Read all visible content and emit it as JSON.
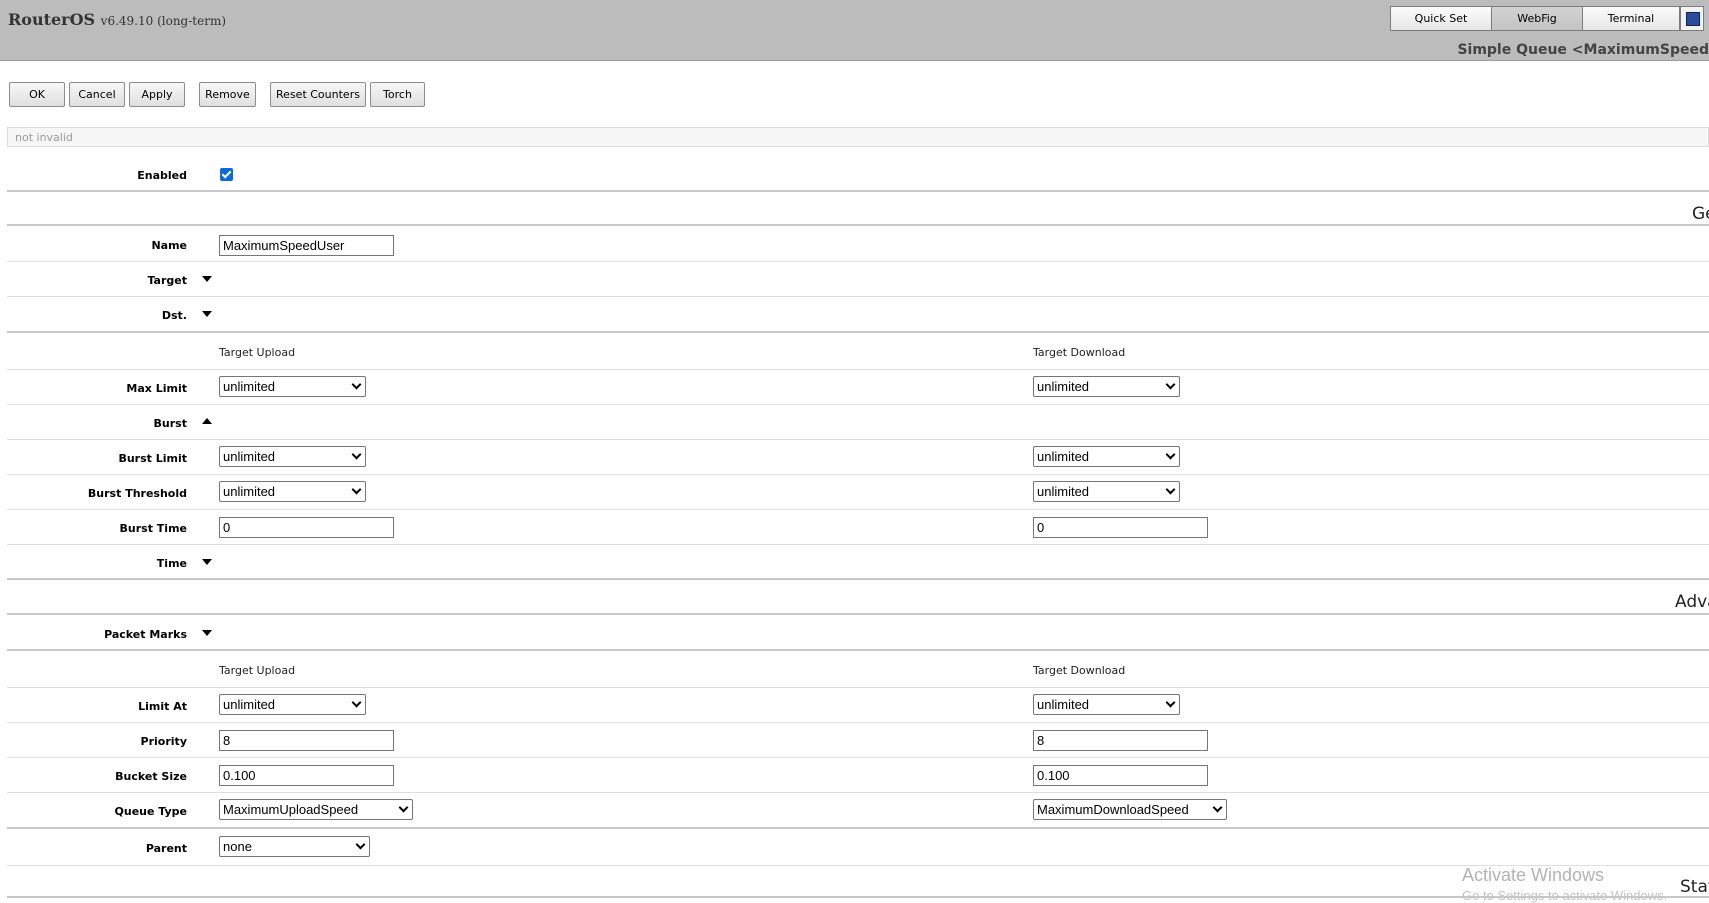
{
  "header": {
    "app_name": "RouterOS",
    "version": "v6.49.10 (long-term)",
    "modes": [
      "Quick Set",
      "WebFig",
      "Terminal"
    ],
    "active_mode": "WebFig",
    "page_title": "Simple Queue <MaximumSpeed"
  },
  "toolbar": {
    "ok": "OK",
    "cancel": "Cancel",
    "apply": "Apply",
    "remove": "Remove",
    "reset_counters": "Reset Counters",
    "torch": "Torch"
  },
  "status": "not invalid",
  "sections": {
    "general": "Ge",
    "advanced": "Adva",
    "statistics": "Stat"
  },
  "columns": {
    "upload": "Target Upload",
    "download": "Target Download"
  },
  "fields": {
    "enabled": {
      "label": "Enabled",
      "checked": true
    },
    "name": {
      "label": "Name",
      "value": "MaximumSpeedUser"
    },
    "target": {
      "label": "Target"
    },
    "dst": {
      "label": "Dst."
    },
    "max_limit": {
      "label": "Max Limit",
      "upload": "unlimited",
      "download": "unlimited"
    },
    "burst": {
      "label": "Burst"
    },
    "burst_limit": {
      "label": "Burst Limit",
      "upload": "unlimited",
      "download": "unlimited"
    },
    "burst_threshold": {
      "label": "Burst Threshold",
      "upload": "unlimited",
      "download": "unlimited"
    },
    "burst_time": {
      "label": "Burst Time",
      "upload": "0",
      "download": "0"
    },
    "time": {
      "label": "Time"
    },
    "packet_marks": {
      "label": "Packet Marks"
    },
    "limit_at": {
      "label": "Limit At",
      "upload": "unlimited",
      "download": "unlimited"
    },
    "priority": {
      "label": "Priority",
      "upload": "8",
      "download": "8"
    },
    "bucket_size": {
      "label": "Bucket Size",
      "upload": "0.100",
      "download": "0.100"
    },
    "queue_type": {
      "label": "Queue Type",
      "upload": "MaximumUploadSpeed",
      "download": "MaximumDownloadSpeed"
    },
    "parent": {
      "label": "Parent",
      "value": "none"
    }
  },
  "watermark": {
    "line1": "Activate Windows",
    "line2": "Go to Settings to activate Windows."
  }
}
